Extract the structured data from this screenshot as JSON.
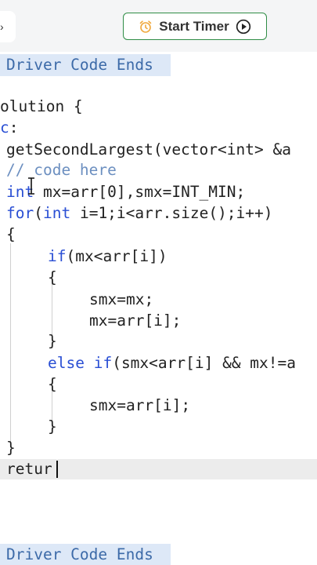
{
  "toolbar": {
    "left_tab_glyph": "›",
    "timer_label": "Start Timer",
    "alarm_icon": "alarm-clock-icon",
    "play_icon": "play-circle-icon",
    "accent_color": "#2f8d46",
    "alarm_color": "#f0a83c"
  },
  "editor": {
    "banner_top": "Driver Code Ends",
    "banner_bottom": "Driver Code Ends",
    "lines": {
      "l1": "olution {",
      "l2a": "c",
      "l2b": ":",
      "l3": "getSecondLargest(vector<int> &a",
      "l4": "// code here",
      "l5a": "int",
      "l5b": " mx=arr[0],smx=INT_MIN;",
      "l6a": "for",
      "l6b": "(",
      "l6c": "int",
      "l6d": " i=1;i<arr.size();i++)",
      "l7": "{",
      "l8a": "if",
      "l8b": "(mx<arr[i])",
      "l9": "{",
      "l10": "smx=mx;",
      "l11": "mx=arr[i];",
      "l12": "}",
      "l13a": "else",
      "l13b": " ",
      "l13c": "if",
      "l13d": "(smx<arr[i] && mx!=a",
      "l14": "{",
      "l15": "smx=arr[i];",
      "l16": "}",
      "l17": "}",
      "l18": "retur"
    }
  }
}
